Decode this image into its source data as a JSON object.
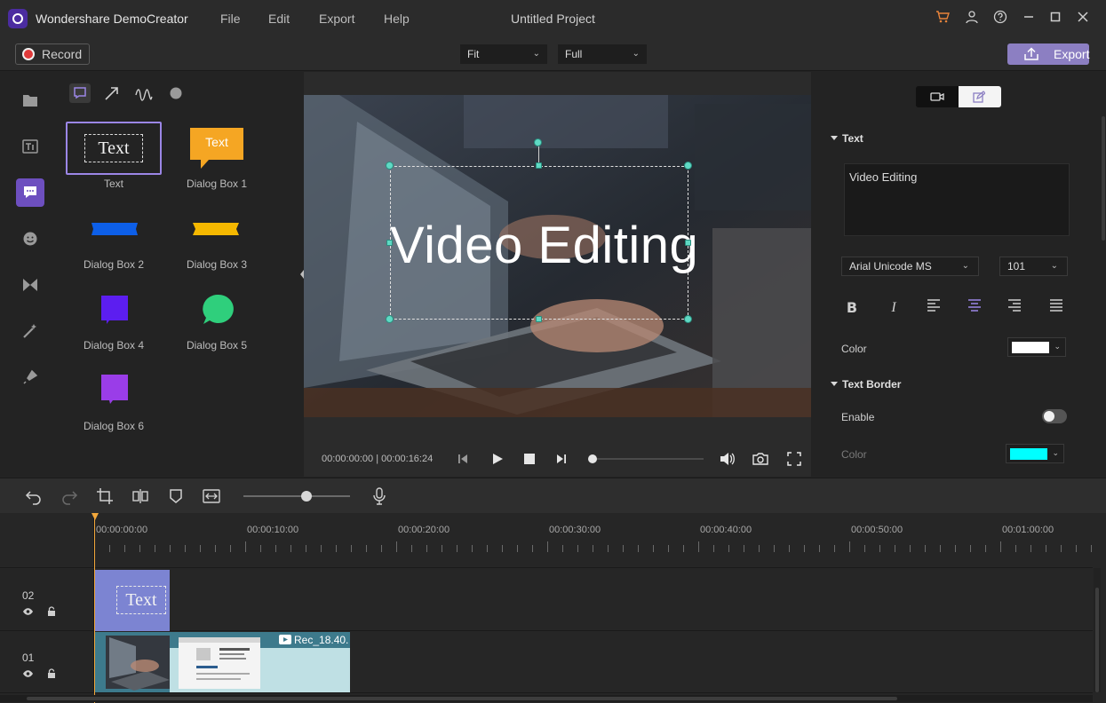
{
  "app": {
    "name": "Wondershare DemoCreator",
    "project_title": "Untitled Project",
    "menu": [
      "File",
      "Edit",
      "Export",
      "Help"
    ]
  },
  "toolbar": {
    "record_label": "Record",
    "fit_value": "Fit",
    "full_value": "Full",
    "export_label": "Export"
  },
  "library": {
    "items": [
      {
        "label": "Text",
        "preview_text": "Text"
      },
      {
        "label": "Dialog Box 1",
        "preview_text": "Text"
      },
      {
        "label": "Dialog Box 2"
      },
      {
        "label": "Dialog Box 3"
      },
      {
        "label": "Dialog Box 4"
      },
      {
        "label": "Dialog Box 5"
      },
      {
        "label": "Dialog Box 6"
      }
    ]
  },
  "preview": {
    "caption_text": "Video Editing",
    "current_time": "00:00:00:00",
    "total_time": "00:00:16:24",
    "progress": 0
  },
  "props": {
    "text_section_title": "Text",
    "text_value": "Video Editing",
    "font_family": "Arial Unicode MS",
    "font_size": "101",
    "color_label": "Color",
    "text_color": "#ffffff",
    "border_section_title": "Text Border",
    "enable_label": "Enable",
    "enable_on": false,
    "border_color_label": "Color",
    "border_color": "#00ffff"
  },
  "timeline": {
    "ruler_labels": [
      "00:00:00:00",
      "00:00:10:00",
      "00:00:20:00",
      "00:00:30:00",
      "00:00:40:00",
      "00:00:50:00",
      "00:01:00:00"
    ],
    "tracks": [
      {
        "number": "02"
      },
      {
        "number": "01"
      }
    ],
    "text_clip_label": "Text",
    "rec_clip_label": "Rec_18.40."
  },
  "colors": {
    "accent": "#6d4fbf",
    "export_button": "#8c7fc2",
    "playhead": "#f2a73b",
    "handle": "#5fd9c4",
    "text_clip": "#7c84d2",
    "video_clip": "#3d7a8c"
  }
}
